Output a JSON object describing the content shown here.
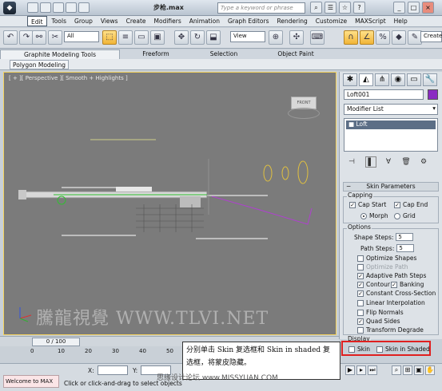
{
  "titlebar": {
    "file_title": "步枪.max",
    "search_placeholder": "Type a keyword or phrase"
  },
  "menu": [
    "Edit",
    "Tools",
    "Group",
    "Views",
    "Create",
    "Modifiers",
    "Animation",
    "Graph Editors",
    "Rendering",
    "Customize",
    "MAXScript",
    "Help"
  ],
  "toolbar": {
    "selection_filter": "All",
    "ref_coord": "View",
    "create_selection": "Create"
  },
  "ribbon": {
    "tabs": [
      "Graphite Modeling Tools",
      "Freeform",
      "Selection",
      "Object Paint"
    ],
    "sub_tab": "Polygon Modeling"
  },
  "viewport": {
    "label": "[ + ][ Perspective ][ Smooth + Highlights ]",
    "cube_label": "FRONT",
    "watermark": "騰龍視覺 WWW.TLVI.NET"
  },
  "cmdpanel": {
    "object_name": "Loft001",
    "object_color": "#8a2bc2",
    "modifier_list": "Modifier List",
    "stack": [
      "Loft"
    ],
    "skin_params": "Skin Parameters",
    "capping": {
      "title": "Capping",
      "cap_start": "Cap Start",
      "cap_end": "Cap End",
      "morph": "Morph",
      "grid": "Grid"
    },
    "options": {
      "title": "Options",
      "shape_steps_label": "Shape Steps:",
      "shape_steps": "5",
      "path_steps_label": "Path Steps:",
      "path_steps": "5",
      "optimize_shapes": "Optimize Shapes",
      "optimize_path": "Optimize Path",
      "adaptive_path_steps": "Adaptive Path Steps",
      "contour": "Contour",
      "banking": "Banking",
      "constant_cross": "Constant Cross-Section",
      "linear_interp": "Linear Interpolation",
      "flip_normals": "Flip Normals",
      "quad_sides": "Quad Sides",
      "transform_degrade": "Transform Degrade"
    },
    "display": {
      "title": "Display",
      "skin": "Skin",
      "skin_in_shaded": "Skin in Shaded"
    }
  },
  "timeline": {
    "frame": "0 / 100",
    "ticks": [
      "0",
      "10",
      "20",
      "30",
      "40",
      "50"
    ]
  },
  "status": {
    "maxscript": "Welcome to MAX",
    "x_label": "X:",
    "y_label": "Y:",
    "prompt": "Click or click-and-drag to select objects"
  },
  "caption": {
    "text": "分别单击 Skin 复选框和 Skin in shaded 复选框，将蒙皮隐藏。"
  },
  "watermark2": "思缘设计论坛 www.MISSYUAN.COM"
}
